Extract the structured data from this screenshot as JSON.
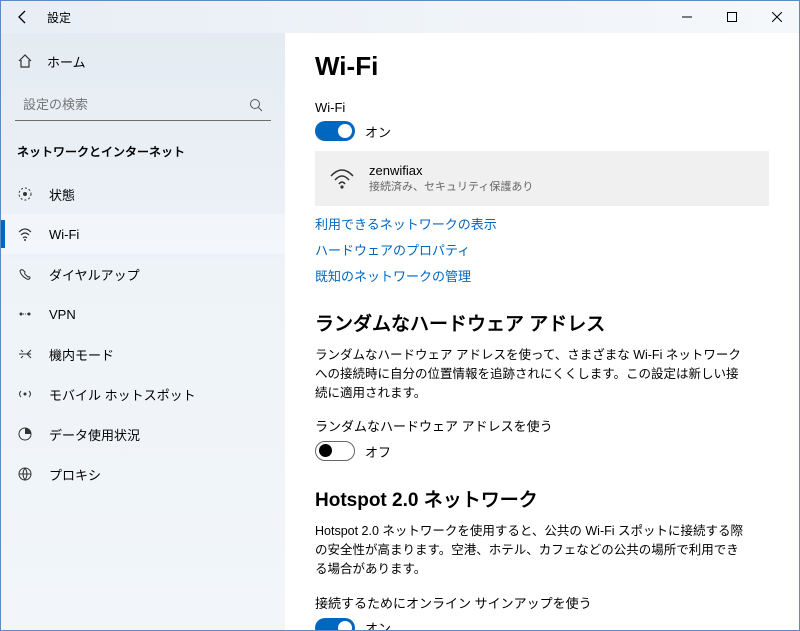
{
  "titlebar": {
    "title": "設定"
  },
  "sidebar": {
    "home": "ホーム",
    "search_placeholder": "設定の検索",
    "section": "ネットワークとインターネット",
    "items": [
      {
        "label": "状態"
      },
      {
        "label": "Wi-Fi"
      },
      {
        "label": "ダイヤルアップ"
      },
      {
        "label": "VPN"
      },
      {
        "label": "機内モード"
      },
      {
        "label": "モバイル ホットスポット"
      },
      {
        "label": "データ使用状況"
      },
      {
        "label": "プロキシ"
      }
    ]
  },
  "content": {
    "heading": "Wi-Fi",
    "wifi_label": "Wi-Fi",
    "wifi_on": "オン",
    "network": {
      "ssid": "zenwifiax",
      "status": "接続済み、セキュリティ保護あり"
    },
    "links": {
      "available_networks": "利用できるネットワークの表示",
      "hw_props": "ハードウェアのプロパティ",
      "known_networks": "既知のネットワークの管理"
    },
    "random": {
      "heading": "ランダムなハードウェア アドレス",
      "desc": "ランダムなハードウェア アドレスを使って、さまざまな Wi-Fi ネットワークへの接続時に自分の位置情報を追跡されにくくします。この設定は新しい接続に適用されます。",
      "toggle_label": "ランダムなハードウェア アドレスを使う",
      "off": "オフ"
    },
    "hotspot": {
      "heading": "Hotspot 2.0 ネットワーク",
      "desc": "Hotspot 2.0 ネットワークを使用すると、公共の Wi-Fi スポットに接続する際の安全性が高まります。空港、ホテル、カフェなどの公共の場所で利用できる場合があります。",
      "toggle_label": "接続するためにオンライン サインアップを使う",
      "on": "オン"
    }
  }
}
